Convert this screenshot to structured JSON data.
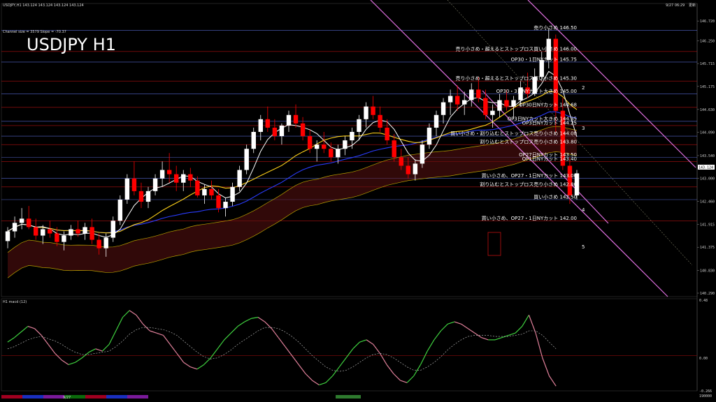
{
  "header": {
    "symbol_line": "USDJPY,H1  143.124 143.124 143.124 143.124",
    "datetime": "9/27 06:29",
    "datetime_suffix": "更新",
    "channel_info": "Channel size = 3579 Slope = -70.37",
    "big_title": "USDJPY H1"
  },
  "indicator_panel": {
    "title": "H1  macd (12)",
    "scale_top": "0.48",
    "scale_zero": "0.00",
    "scale_bottom": "-0.266",
    "right_note": "190000"
  },
  "bottom_bar": {
    "date_label": "9/27"
  },
  "current_price": "143.124",
  "colors": {
    "up": "#ffffff",
    "down": "#ff0000",
    "channel": "#e070e0",
    "ma_white": "#ffffff",
    "ma_yellow": "#ffd21a",
    "ma_blue": "#2a3cff",
    "macd_green": "#3fd13f",
    "macd_pink": "#e0809a",
    "ref_line": "#5566cc",
    "red_line": "#b01010"
  },
  "chart_data": {
    "type": "candlestick",
    "ylim": [
      140.29,
      146.92
    ],
    "y_ticks": [
      "146.720",
      "146.250",
      "145.715",
      "145.175",
      "144.630",
      "144.090",
      "143.540",
      "143.000",
      "142.460",
      "141.915",
      "141.375",
      "140.830",
      "140.290"
    ],
    "levels": [
      {
        "price": 146.5,
        "label": "売り小さめ 146.50"
      },
      {
        "price": 146.0,
        "label": "売り小さめ・超えるとストップロス買い小さめ 146.00"
      },
      {
        "price": 145.75,
        "label": "OP30・1日NYカット 145.75"
      },
      {
        "price": 145.3,
        "label": "売り小さめ・超えるとストップロス買い小さめ 145.30"
      },
      {
        "price": 145.0,
        "label": "OP30・3日NYカット大きめ 145.00"
      },
      {
        "price": 144.68,
        "label": "OP30日NYカット 144.68"
      },
      {
        "price": 144.35,
        "label": "OP3日NYカット大きめ 144.35"
      },
      {
        "price": 144.25,
        "label": "OP3日NYカット 144.25"
      },
      {
        "price": 144.0,
        "label": "買い小さめ・割り込むとストップロス売り小さめ 144.00"
      },
      {
        "price": 143.8,
        "label": "割り込むとストップロス売り小さめ 143.80"
      },
      {
        "price": 143.5,
        "label": "OP27日NYカット 143.50"
      },
      {
        "price": 143.4,
        "label": "OP1日NYカット 143.40"
      },
      {
        "price": 143.0,
        "label": "買い小さめ、OP27・1日NYカット 143.00"
      },
      {
        "price": 142.8,
        "label": "割り込むとストップロス売り小さめ 142.80"
      },
      {
        "price": 142.5,
        "label": "買い小さめ 142.50"
      },
      {
        "price": 142.0,
        "label": "買い小さめ、OP27・1日NYカット 142.00"
      }
    ],
    "wave_labels": [
      "2",
      "3",
      "4",
      "5"
    ],
    "ohlc": [
      [
        141.52,
        141.85,
        141.35,
        141.75
      ],
      [
        141.75,
        142.1,
        141.6,
        141.95
      ],
      [
        141.95,
        142.3,
        141.8,
        142.05
      ],
      [
        142.05,
        142.35,
        141.8,
        141.85
      ],
      [
        141.85,
        142.05,
        141.55,
        141.65
      ],
      [
        141.65,
        141.9,
        141.45,
        141.8
      ],
      [
        141.8,
        142.0,
        141.6,
        141.7
      ],
      [
        141.7,
        141.85,
        141.4,
        141.5
      ],
      [
        141.5,
        141.75,
        141.3,
        141.65
      ],
      [
        141.65,
        141.9,
        141.55,
        141.8
      ],
      [
        141.8,
        142.0,
        141.62,
        141.7
      ],
      [
        141.7,
        141.95,
        141.55,
        141.85
      ],
      [
        141.85,
        142.05,
        141.45,
        141.55
      ],
      [
        141.55,
        141.7,
        141.2,
        141.35
      ],
      [
        141.35,
        141.7,
        141.15,
        141.6
      ],
      [
        141.6,
        142.1,
        141.5,
        142.0
      ],
      [
        142.0,
        142.6,
        141.9,
        142.5
      ],
      [
        142.5,
        143.1,
        142.4,
        143.0
      ],
      [
        143.0,
        143.4,
        142.6,
        142.7
      ],
      [
        142.7,
        142.9,
        142.3,
        142.45
      ],
      [
        142.45,
        142.8,
        142.3,
        142.7
      ],
      [
        142.7,
        143.1,
        142.6,
        143.0
      ],
      [
        143.0,
        143.4,
        142.8,
        143.2
      ],
      [
        143.2,
        143.6,
        142.9,
        143.1
      ],
      [
        143.1,
        143.3,
        142.7,
        142.9
      ],
      [
        142.9,
        143.2,
        142.7,
        143.1
      ],
      [
        143.1,
        143.25,
        142.8,
        142.95
      ],
      [
        142.95,
        143.05,
        142.55,
        142.6
      ],
      [
        142.6,
        142.85,
        142.4,
        142.75
      ],
      [
        142.75,
        142.95,
        142.5,
        142.6
      ],
      [
        142.6,
        142.75,
        142.2,
        142.3
      ],
      [
        142.3,
        142.55,
        142.1,
        142.45
      ],
      [
        142.45,
        142.9,
        142.35,
        142.8
      ],
      [
        142.8,
        143.3,
        142.7,
        143.2
      ],
      [
        143.2,
        143.8,
        143.1,
        143.7
      ],
      [
        143.7,
        144.2,
        143.6,
        144.1
      ],
      [
        144.1,
        144.5,
        143.9,
        144.4
      ],
      [
        144.4,
        144.7,
        144.1,
        144.2
      ],
      [
        144.2,
        144.4,
        143.9,
        144.0
      ],
      [
        144.0,
        144.3,
        143.8,
        144.25
      ],
      [
        144.25,
        144.6,
        144.1,
        144.5
      ],
      [
        144.5,
        144.75,
        144.2,
        144.3
      ],
      [
        144.3,
        144.45,
        143.9,
        144.0
      ],
      [
        144.0,
        144.15,
        143.6,
        143.7
      ],
      [
        143.7,
        143.9,
        143.4,
        143.8
      ],
      [
        143.8,
        144.1,
        143.6,
        143.7
      ],
      [
        143.7,
        143.85,
        143.4,
        143.5
      ],
      [
        143.5,
        143.8,
        143.35,
        143.7
      ],
      [
        143.7,
        144.0,
        143.55,
        143.9
      ],
      [
        143.9,
        144.2,
        143.7,
        144.1
      ],
      [
        144.1,
        144.5,
        143.9,
        144.4
      ],
      [
        144.4,
        144.8,
        144.2,
        144.7
      ],
      [
        144.7,
        144.95,
        144.4,
        144.5
      ],
      [
        144.5,
        144.7,
        144.1,
        144.2
      ],
      [
        144.2,
        144.4,
        143.8,
        143.9
      ],
      [
        143.9,
        144.05,
        143.4,
        143.5
      ],
      [
        143.5,
        143.7,
        143.2,
        143.3
      ],
      [
        143.3,
        143.5,
        143.0,
        143.1
      ],
      [
        143.1,
        143.45,
        142.95,
        143.35
      ],
      [
        143.35,
        143.9,
        143.25,
        143.8
      ],
      [
        143.8,
        144.3,
        143.7,
        144.2
      ],
      [
        144.2,
        144.6,
        144.0,
        144.5
      ],
      [
        144.5,
        144.9,
        144.3,
        144.8
      ],
      [
        144.8,
        145.1,
        144.5,
        144.95
      ],
      [
        144.95,
        145.2,
        144.6,
        144.75
      ],
      [
        144.75,
        145.05,
        144.5,
        144.85
      ],
      [
        144.85,
        145.25,
        144.7,
        145.1
      ],
      [
        145.1,
        145.4,
        144.8,
        144.9
      ],
      [
        144.9,
        145.1,
        144.4,
        144.5
      ],
      [
        144.5,
        144.75,
        144.2,
        144.6
      ],
      [
        144.6,
        145.0,
        144.45,
        144.85
      ],
      [
        144.85,
        145.1,
        144.6,
        144.7
      ],
      [
        144.7,
        144.95,
        144.4,
        144.85
      ],
      [
        144.85,
        145.3,
        144.7,
        145.15
      ],
      [
        145.15,
        145.5,
        144.9,
        145.0
      ],
      [
        145.0,
        145.6,
        144.95,
        145.4
      ],
      [
        145.4,
        146.0,
        145.3,
        145.8
      ],
      [
        145.8,
        146.55,
        145.6,
        146.3
      ],
      [
        146.3,
        146.4,
        144.1,
        144.6
      ],
      [
        144.6,
        144.9,
        143.2,
        143.3
      ],
      [
        143.3,
        143.5,
        142.4,
        142.6
      ],
      [
        142.6,
        143.2,
        142.5,
        143.12
      ]
    ],
    "macd": [
      0.12,
      0.16,
      0.21,
      0.26,
      0.24,
      0.18,
      0.1,
      0.02,
      -0.04,
      -0.08,
      -0.06,
      -0.02,
      0.03,
      0.06,
      0.04,
      0.1,
      0.22,
      0.34,
      0.4,
      0.36,
      0.28,
      0.22,
      0.2,
      0.18,
      0.1,
      0.02,
      -0.06,
      -0.1,
      -0.12,
      -0.08,
      -0.02,
      0.06,
      0.14,
      0.2,
      0.26,
      0.3,
      0.33,
      0.34,
      0.3,
      0.24,
      0.16,
      0.08,
      0.0,
      -0.08,
      -0.16,
      -0.22,
      -0.26,
      -0.24,
      -0.18,
      -0.1,
      -0.02,
      0.06,
      0.12,
      0.14,
      0.1,
      0.02,
      -0.08,
      -0.16,
      -0.22,
      -0.24,
      -0.18,
      -0.08,
      0.04,
      0.14,
      0.22,
      0.28,
      0.3,
      0.28,
      0.24,
      0.2,
      0.16,
      0.14,
      0.14,
      0.16,
      0.18,
      0.2,
      0.26,
      0.36,
      0.2,
      -0.02,
      -0.18,
      -0.27
    ],
    "macd_signal": [
      0.06,
      0.08,
      0.11,
      0.14,
      0.16,
      0.17,
      0.15,
      0.13,
      0.1,
      0.06,
      0.03,
      0.01,
      0.01,
      0.02,
      0.03,
      0.04,
      0.08,
      0.13,
      0.19,
      0.23,
      0.25,
      0.25,
      0.24,
      0.23,
      0.21,
      0.18,
      0.13,
      0.08,
      0.03,
      -0.01,
      -0.03,
      -0.02,
      0.01,
      0.05,
      0.1,
      0.14,
      0.18,
      0.22,
      0.25,
      0.25,
      0.24,
      0.21,
      0.17,
      0.12,
      0.06,
      0.0,
      -0.05,
      -0.1,
      -0.13,
      -0.14,
      -0.13,
      -0.1,
      -0.06,
      -0.02,
      0.01,
      0.02,
      0.01,
      -0.02,
      -0.06,
      -0.1,
      -0.13,
      -0.13,
      -0.1,
      -0.06,
      -0.01,
      0.05,
      0.1,
      0.14,
      0.17,
      0.18,
      0.18,
      0.18,
      0.17,
      0.17,
      0.17,
      0.18,
      0.19,
      0.22,
      0.22,
      0.18,
      0.12,
      0.06
    ]
  }
}
